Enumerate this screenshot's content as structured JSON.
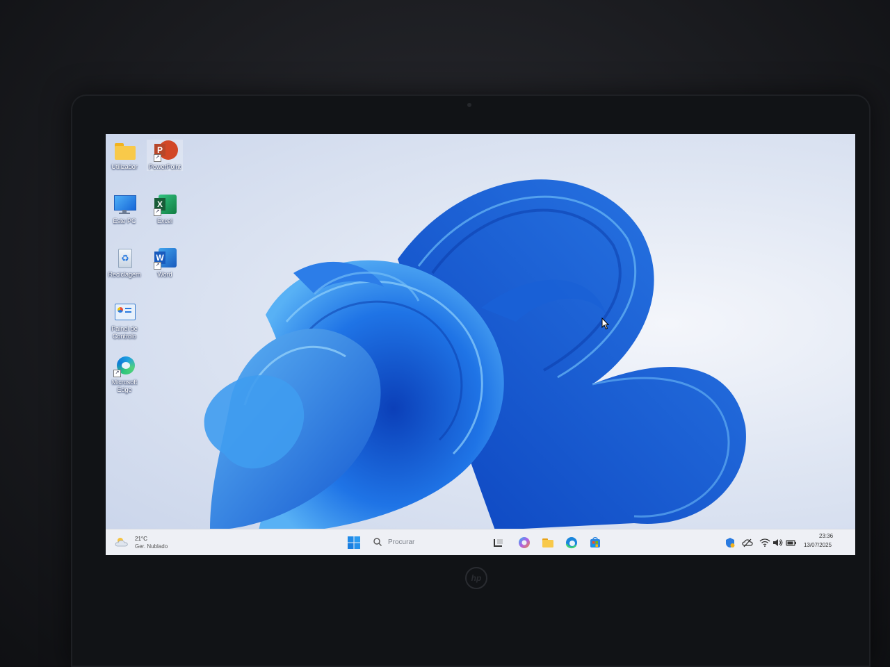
{
  "desktop": {
    "icons": [
      {
        "label": "Utilizador",
        "icon": "folder-icon"
      },
      {
        "label": "PowerPoint",
        "icon": "powerpoint-icon",
        "letter": "P"
      },
      {
        "label": "Este PC",
        "icon": "monitor-icon"
      },
      {
        "label": "Excel",
        "icon": "excel-icon",
        "letter": "X"
      },
      {
        "label": "Reciclagem",
        "icon": "recycle-bin-icon",
        "letter": "♻"
      },
      {
        "label": "Word",
        "icon": "word-icon",
        "letter": "W"
      },
      {
        "label": "Painel de Controlo",
        "icon": "control-panel-icon"
      },
      {
        "label": "Microsoft Edge",
        "icon": "edge-icon"
      }
    ]
  },
  "taskbar": {
    "weather": {
      "temp": "21°C",
      "condition": "Ger. Nublado"
    },
    "search": {
      "placeholder": "Procurar"
    },
    "clock": {
      "time": "23:36",
      "date": "13/07/2025"
    }
  },
  "colors": {
    "accent": "#1f6fe0",
    "wallpaper_blue": "#1b5fd8",
    "taskbar_bg": "#eef0f5"
  }
}
